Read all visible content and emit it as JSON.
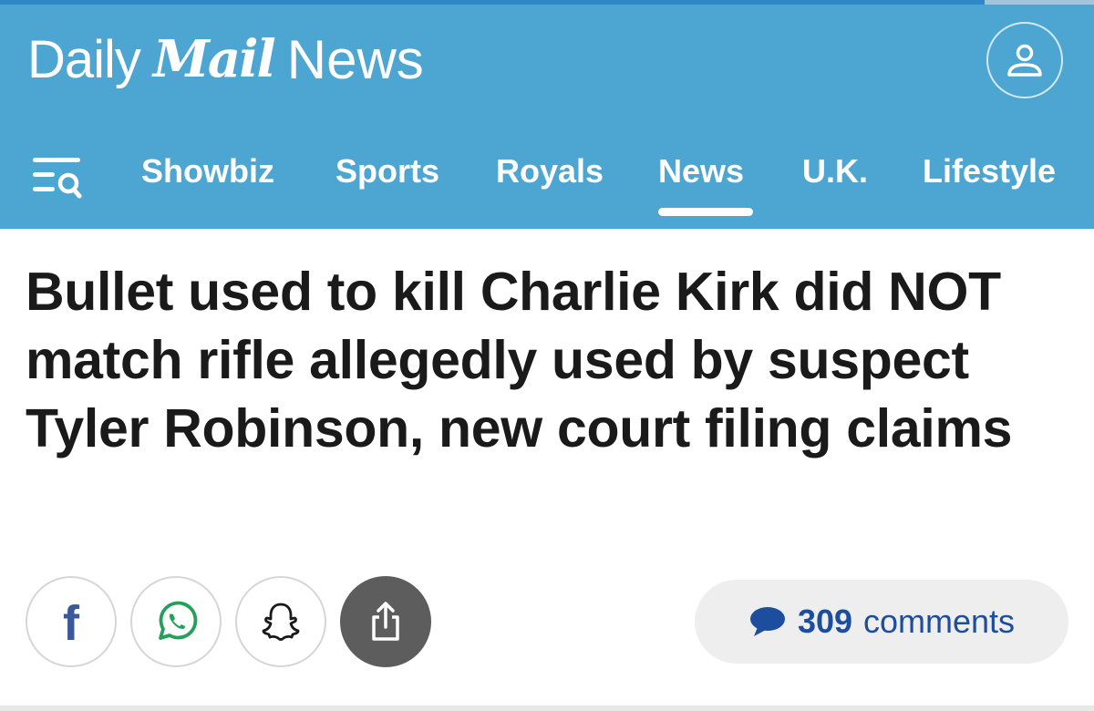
{
  "progress": {
    "fraction": 0.9
  },
  "brand": {
    "daily": "Daily",
    "mail": "Mail",
    "news": "News"
  },
  "header": {
    "account_icon": "user-icon",
    "menu_icon": "menu-search-icon"
  },
  "nav": {
    "items": [
      {
        "label": "Showbiz",
        "active": false
      },
      {
        "label": "Sports",
        "active": false
      },
      {
        "label": "Royals",
        "active": false
      },
      {
        "label": "News",
        "active": true
      },
      {
        "label": "U.K.",
        "active": false
      },
      {
        "label": "Lifestyle",
        "active": false
      }
    ]
  },
  "article": {
    "headline": "Bullet used to kill Charlie Kirk did NOT match rifle allegedly used by suspect Tyler Robinson, new court filing claims"
  },
  "share": {
    "buttons": [
      {
        "icon": "facebook-icon",
        "label": "f"
      },
      {
        "icon": "whatsapp-icon"
      },
      {
        "icon": "snapchat-icon"
      },
      {
        "icon": "share-icon"
      }
    ]
  },
  "comments": {
    "count": "309",
    "label": "comments",
    "icon": "speech-bubble-icon"
  },
  "colors": {
    "header_bg": "#4da6d1",
    "text": "#1a1a1a",
    "comments_link": "#1d4e9e",
    "share_dark": "#5d5d5d"
  }
}
